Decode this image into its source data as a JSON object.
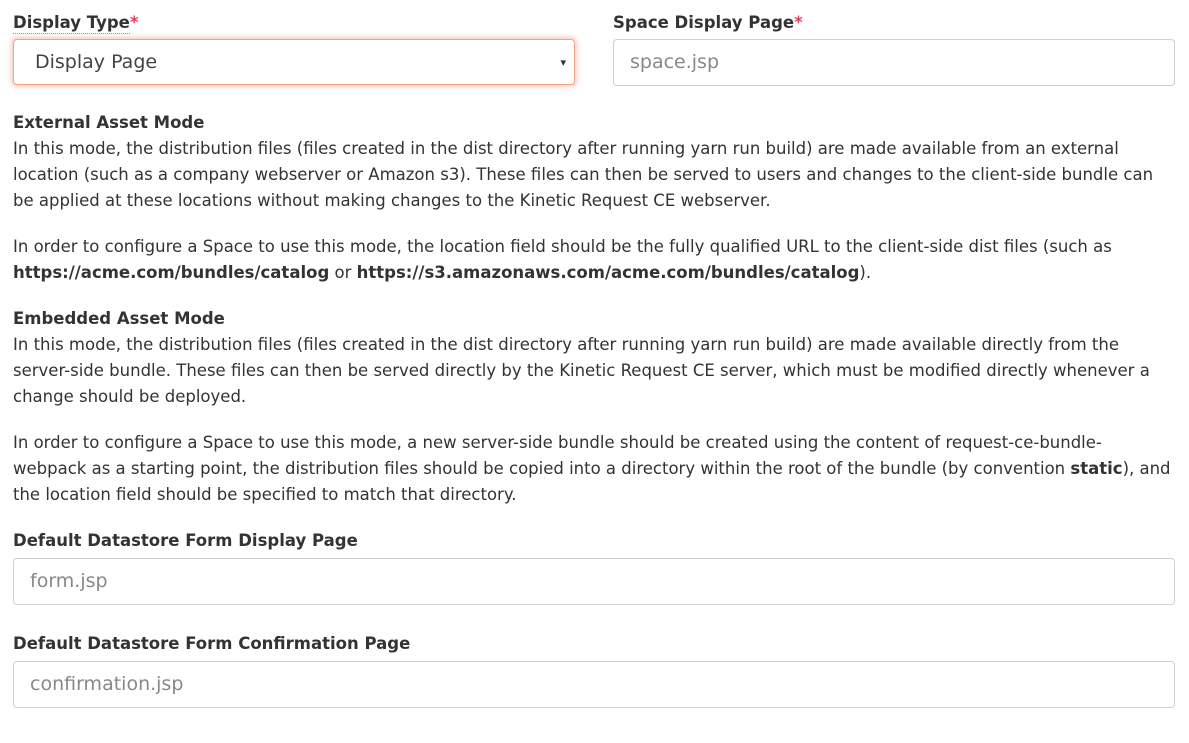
{
  "display_type": {
    "label": "Display Type",
    "required_mark": "*",
    "selected_value": "Display Page",
    "arrow": "▾"
  },
  "space_display_page": {
    "label": "Space Display Page",
    "required_mark": "*",
    "placeholder": "space.jsp"
  },
  "external_asset_mode": {
    "title": "External Asset Mode",
    "paragraph1": "In this mode, the distribution files (files created in the dist directory after running yarn run build) are made available from an external location (such as a company webserver or Amazon s3). These files can then be served to users and changes to the client-side bundle can be applied at these locations without making changes to the Kinetic Request CE webserver.",
    "paragraph2_start": "In order to configure a Space to use this mode, the location field should be the fully qualified URL to the client-side dist files (such as ",
    "url1": "https://acme.com/bundles/catalog",
    "or_text": " or ",
    "url2": "https://s3.amazonaws.com/acme.com/bundles/catalog",
    "paragraph2_end": ")."
  },
  "embedded_asset_mode": {
    "title": "Embedded Asset Mode",
    "paragraph1": "In this mode, the distribution files (files created in the dist directory after running yarn run build) are made available directly from the server-side bundle. These files can then be served directly by the Kinetic Request CE server, which must be modified directly whenever a change should be deployed.",
    "paragraph2_start": "In order to configure a Space to use this mode, a new server-side bundle should be created using the content of request-ce-bundle-webpack as a starting point, the distribution files should be copied into a directory within the root of the bundle (by convention ",
    "static_word": "static",
    "paragraph2_end": "), and the location field should be specified to match that directory."
  },
  "datastore_display_page": {
    "label": "Default Datastore Form Display Page",
    "placeholder": "form.jsp"
  },
  "datastore_confirmation_page": {
    "label": "Default Datastore Form Confirmation Page",
    "placeholder": "confirmation.jsp"
  }
}
